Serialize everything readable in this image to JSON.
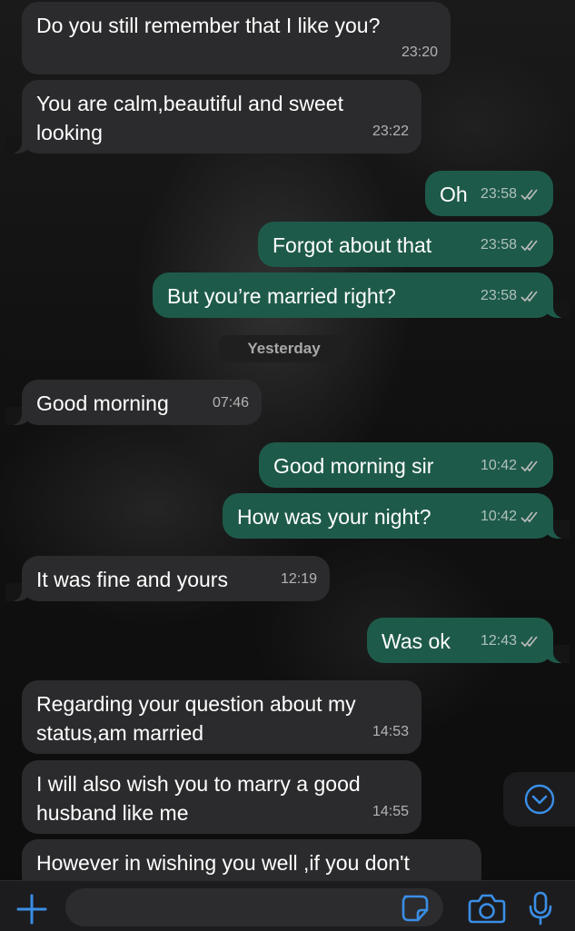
{
  "colors": {
    "incoming_bubble": "#2b2b2d",
    "outgoing_bubble": "#1e5a4a",
    "accent": "#3a8ee6"
  },
  "messages": [
    {
      "text": "Do you still remember that I like you?",
      "time": "23:20",
      "direction": "incoming"
    },
    {
      "text": "You are calm,beautiful and sweet looking",
      "time": "23:22",
      "direction": "incoming"
    },
    {
      "text": "Oh",
      "time": "23:58",
      "direction": "outgoing",
      "status": "read"
    },
    {
      "text": "Forgot about that",
      "time": "23:58",
      "direction": "outgoing",
      "status": "read"
    },
    {
      "text": "But you’re married right?",
      "time": "23:58",
      "direction": "outgoing",
      "status": "read"
    },
    {
      "text": "Good morning",
      "time": "07:46",
      "direction": "incoming"
    },
    {
      "text": "Good morning sir",
      "time": "10:42",
      "direction": "outgoing",
      "status": "read"
    },
    {
      "text": "How was your night?",
      "time": "10:42",
      "direction": "outgoing",
      "status": "read"
    },
    {
      "text": "It was fine and yours",
      "time": "12:19",
      "direction": "incoming"
    },
    {
      "text": "Was ok",
      "time": "12:43",
      "direction": "outgoing",
      "status": "read"
    },
    {
      "text": "Regarding your question about my status,am married",
      "time": "14:53",
      "direction": "incoming"
    },
    {
      "text": "I will also wish you to marry a good husband like me",
      "time": "14:55",
      "direction": "incoming"
    },
    {
      "text": "However in wishing you well ,if you don't",
      "time": "",
      "direction": "incoming"
    }
  ],
  "date_separator": "Yesterday",
  "bottom_bar": {
    "icons": [
      "plus-icon",
      "sticker-icon",
      "camera-icon",
      "microphone-icon"
    ],
    "input_value": ""
  },
  "scroll_button_icon": "chevron-down-icon"
}
